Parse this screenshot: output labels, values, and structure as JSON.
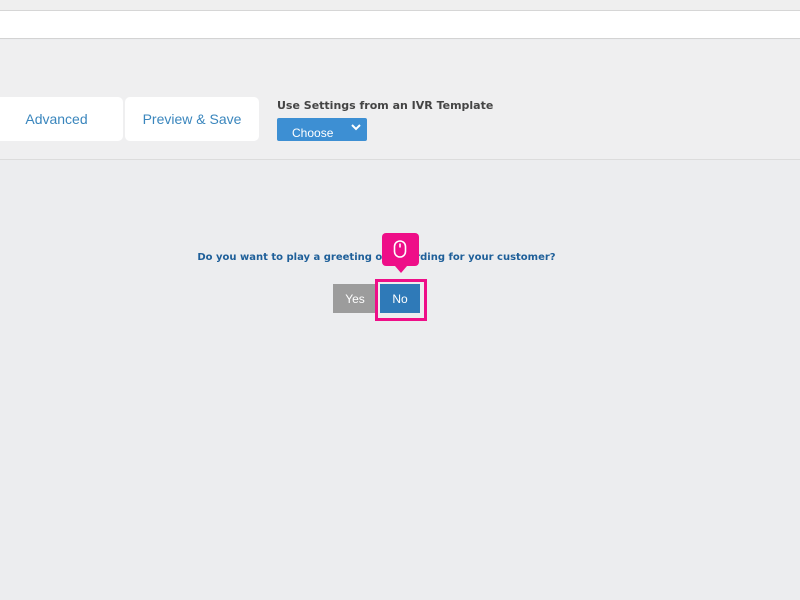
{
  "tabs": [
    {
      "label": "Advanced"
    },
    {
      "label": "Preview & Save"
    }
  ],
  "template": {
    "label": "Use Settings from an IVR Template",
    "select_value": "Choose"
  },
  "prompt": {
    "question": "Do you want to play a greeting or recording for your customer?",
    "yes_label": "Yes",
    "no_label": "No"
  },
  "colors": {
    "accent": "#3d8fd3",
    "no_button": "#2f7ab8",
    "yes_button": "#9c9c9c",
    "question_text": "#1e5f99",
    "click_indicator": "#ee0e88"
  },
  "icons": {
    "select_chevron": "chevron-down-icon",
    "click_indicator": "mouse-icon"
  }
}
